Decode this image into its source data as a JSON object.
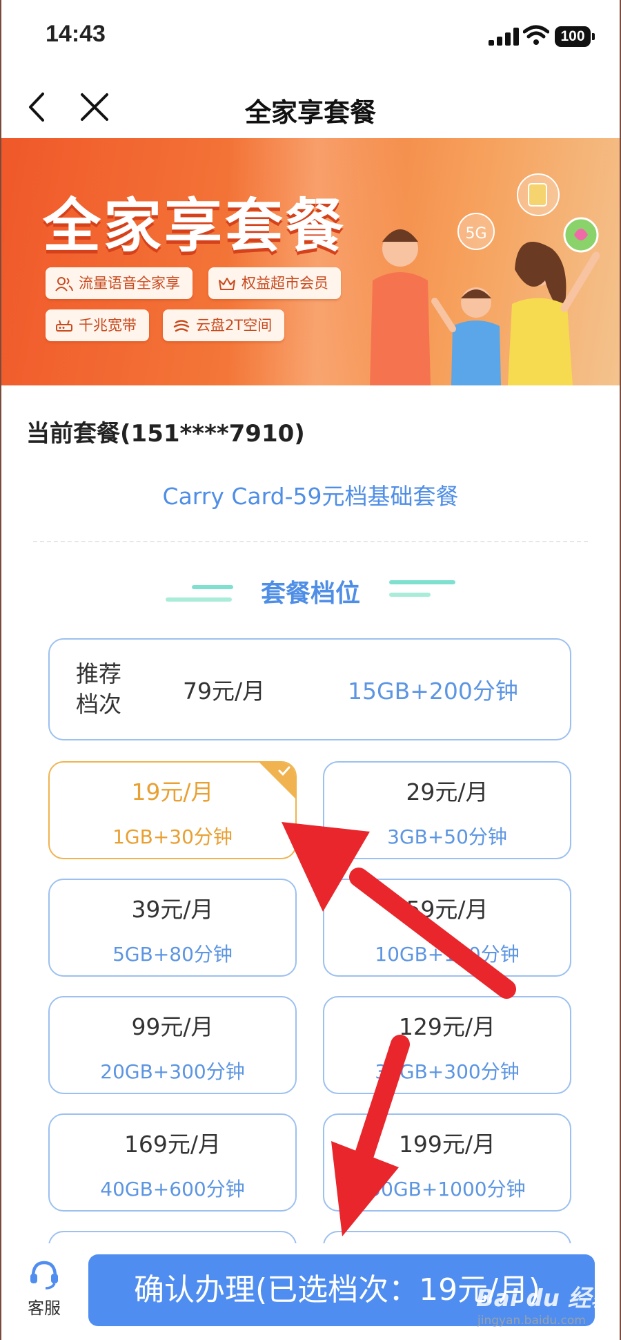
{
  "status_bar": {
    "time": "14:43",
    "battery": "100"
  },
  "nav": {
    "title": "全家享套餐"
  },
  "banner": {
    "title": "全家享套餐",
    "chips": [
      "流量语音全家享",
      "权益超市会员",
      "千兆宽带",
      "云盘2T空间"
    ],
    "bubble_label": "5G"
  },
  "current": {
    "label": "当前套餐(151****7910)",
    "plan_name": "Carry Card-59元档基础套餐"
  },
  "section": {
    "title": "套餐档位"
  },
  "recommended": {
    "tag": "推荐档次",
    "price": "79元/月",
    "data": "15GB+200分钟"
  },
  "plans": [
    {
      "price": "19元/月",
      "data": "1GB+30分钟",
      "selected": true
    },
    {
      "price": "29元/月",
      "data": "3GB+50分钟",
      "selected": false
    },
    {
      "price": "39元/月",
      "data": "5GB+80分钟",
      "selected": false
    },
    {
      "price": "59元/月",
      "data": "10GB+150分钟",
      "selected": false
    },
    {
      "price": "99元/月",
      "data": "20GB+300分钟",
      "selected": false
    },
    {
      "price": "129元/月",
      "data": "30GB+300分钟",
      "selected": false
    },
    {
      "price": "169元/月",
      "data": "40GB+600分钟",
      "selected": false
    },
    {
      "price": "199元/月",
      "data": "50GB+1000分钟",
      "selected": false
    }
  ],
  "bottom": {
    "service_label": "客服",
    "confirm_label": "确认办理(已选档次：19元/月)"
  },
  "watermark": {
    "logo": "Bai du 经验",
    "sub": "jingyan.baidu.com"
  },
  "colors": {
    "accent": "#4f8ee6",
    "selected": "#f0b34f",
    "banner": "#f0582a",
    "annotation_arrow": "#e8262b"
  }
}
